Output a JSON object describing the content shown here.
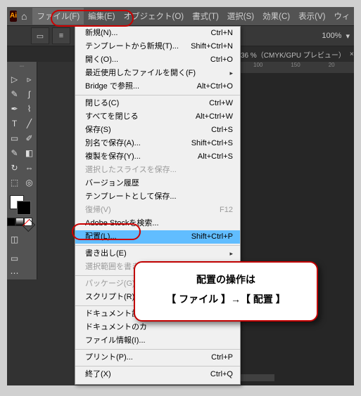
{
  "menubar": {
    "items": [
      "ファイル(F)",
      "編集(E)",
      "オブジェクト(O)",
      "書式(T)",
      "選択(S)",
      "効果(C)",
      "表示(V)",
      "ウィ"
    ]
  },
  "controlbar": {
    "zoom": "100%"
  },
  "tab": {
    "label": "36 %（CMYK/GPU プレビュー）"
  },
  "ruler": {
    "t1": "100",
    "t2": "150",
    "t3": "20"
  },
  "dropdown": {
    "items": [
      {
        "label": "新規(N)...",
        "shortcut": "Ctrl+N"
      },
      {
        "label": "テンプレートから新規(T)...",
        "shortcut": "Shift+Ctrl+N"
      },
      {
        "label": "開く(O)...",
        "shortcut": "Ctrl+O"
      },
      {
        "label": "最近使用したファイルを開く(F)",
        "arrow": true
      },
      {
        "label": "Bridge で参照...",
        "shortcut": "Alt+Ctrl+O"
      },
      {
        "sep": true
      },
      {
        "label": "閉じる(C)",
        "shortcut": "Ctrl+W"
      },
      {
        "label": "すべてを閉じる",
        "shortcut": "Alt+Ctrl+W"
      },
      {
        "label": "保存(S)",
        "shortcut": "Ctrl+S"
      },
      {
        "label": "別名で保存(A)...",
        "shortcut": "Shift+Ctrl+S"
      },
      {
        "label": "複製を保存(Y)...",
        "shortcut": "Alt+Ctrl+S"
      },
      {
        "label": "選択したスライスを保存...",
        "disabled": true
      },
      {
        "label": "バージョン履歴"
      },
      {
        "label": "テンプレートとして保存..."
      },
      {
        "label": "復帰(V)",
        "shortcut": "F12",
        "disabled": true
      },
      {
        "label": "Adobe Stockを検索..."
      },
      {
        "label": "配置(L)...",
        "shortcut": "Shift+Ctrl+P",
        "highlight": true
      },
      {
        "sep": true
      },
      {
        "label": "書き出し(E)",
        "arrow": true
      },
      {
        "label": "選択範囲を書き出し...",
        "disabled": true
      },
      {
        "sep": true
      },
      {
        "label": "パッケージ(G)...",
        "disabled": true
      },
      {
        "label": "スクリプト(R)",
        "arrow": true
      },
      {
        "sep": true
      },
      {
        "label": "ドキュメント設定"
      },
      {
        "label": "ドキュメントのカ"
      },
      {
        "label": "ファイル情報(I)..."
      },
      {
        "sep": true
      },
      {
        "label": "プリント(P)...",
        "shortcut": "Ctrl+P"
      },
      {
        "sep": true
      },
      {
        "label": "終了(X)",
        "shortcut": "Ctrl+Q"
      }
    ]
  },
  "callout": {
    "line1": "配置の操作は",
    "line2": "【 ファイル 】→【 配置 】"
  }
}
